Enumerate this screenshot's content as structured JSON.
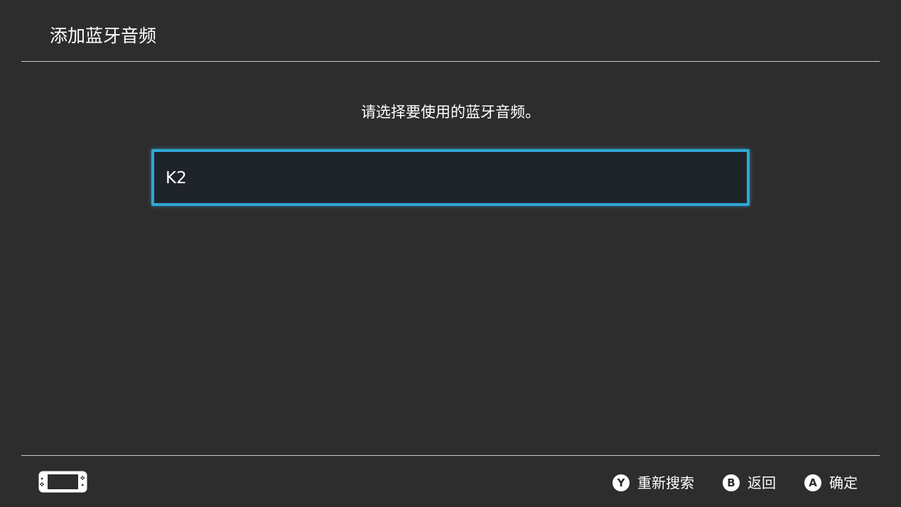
{
  "header": {
    "title": "添加蓝牙音频"
  },
  "prompt": "请选择要使用的蓝牙音频。",
  "devices": [
    {
      "name": "K2",
      "selected": true
    }
  ],
  "footer": {
    "console_icon": "handheld-console-icon",
    "hints": [
      {
        "button": "Y",
        "label": "重新搜索"
      },
      {
        "button": "B",
        "label": "返回"
      },
      {
        "button": "A",
        "label": "确定"
      }
    ]
  },
  "colors": {
    "background": "#2d2d2d",
    "selection_border": "#2fa6d6",
    "item_background": "#1f232a",
    "divider": "#cfcfcf"
  }
}
